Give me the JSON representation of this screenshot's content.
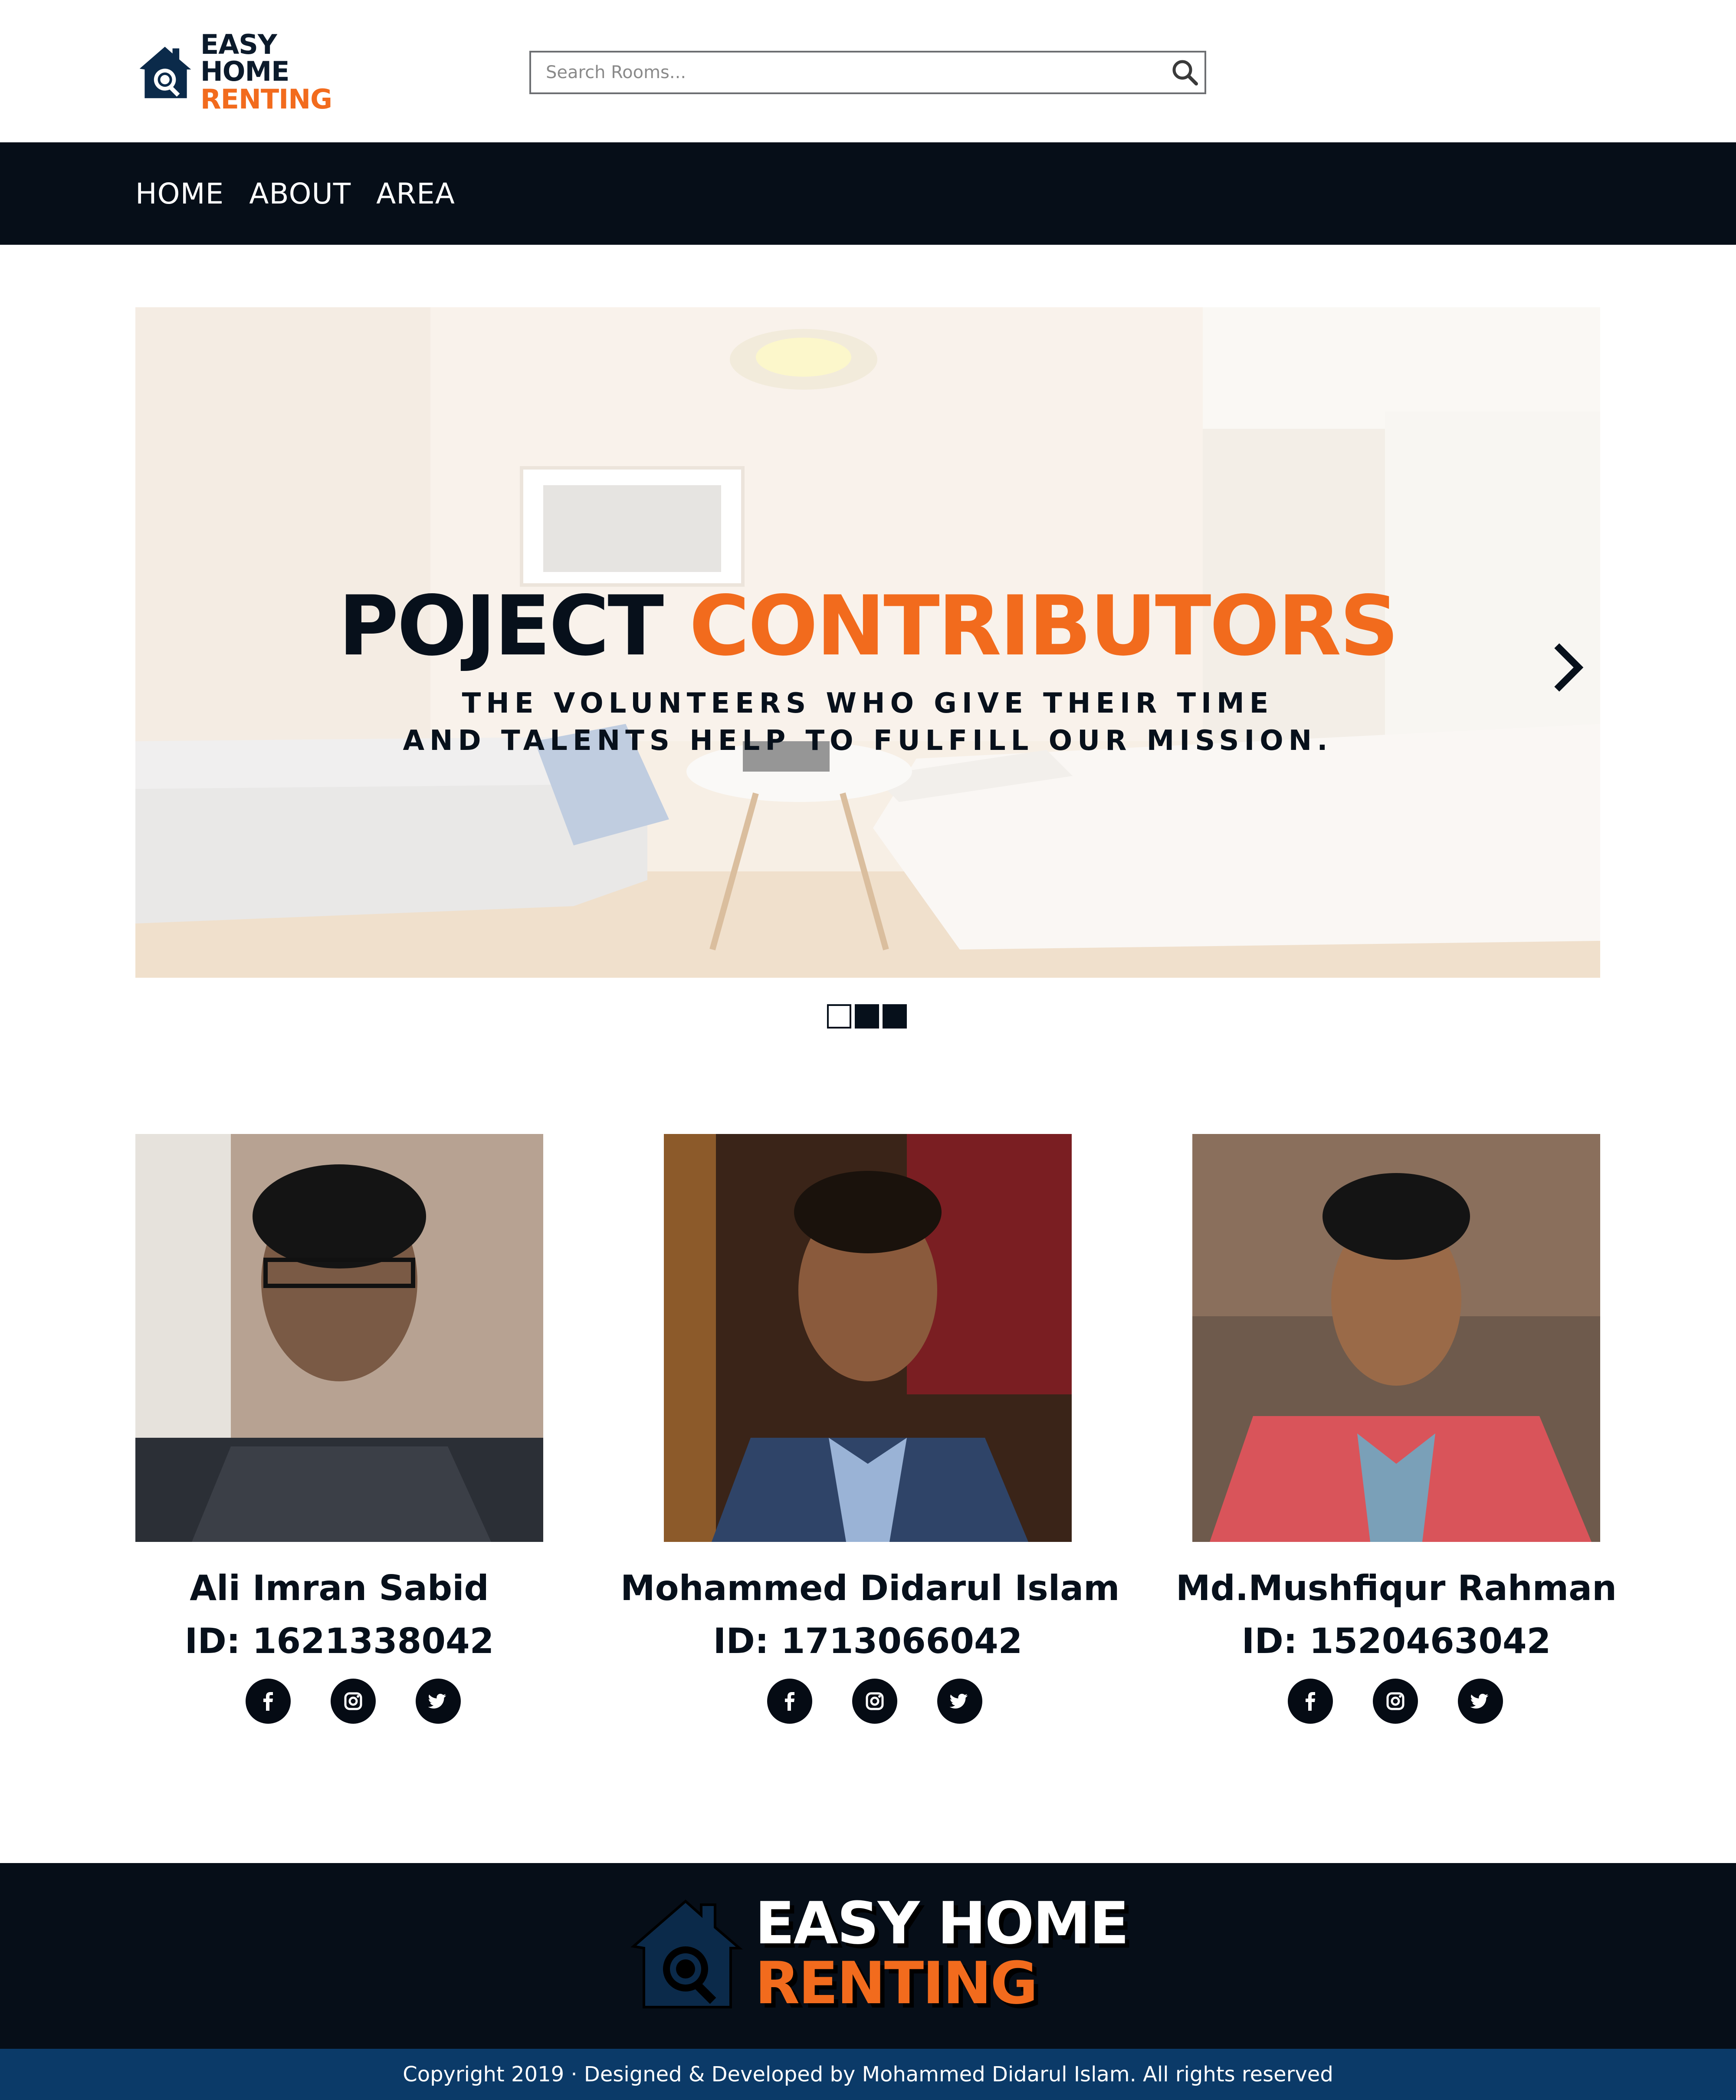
{
  "brand": {
    "line1": "EASY HOME",
    "line2": "RENTING",
    "colors": {
      "navy": "#0b1a2b",
      "orange": "#f26b1d",
      "dark": "#060e18",
      "footer_bar": "#0b3a68"
    }
  },
  "search": {
    "placeholder": "Search Rooms..."
  },
  "nav": {
    "items": [
      "HOME",
      "ABOUT",
      "AREA"
    ]
  },
  "hero": {
    "title_part1": "POJECT",
    "title_part2": "CONTRIBUTORS",
    "subtitle_line1": "THE VOLUNTEERS WHO GIVE THEIR TIME",
    "subtitle_line2": "AND TALENTS HELP TO FULFILL OUR MISSION.",
    "slides": 3,
    "active_slide": 1
  },
  "team": [
    {
      "name": "Ali Imran Sabid",
      "id": "ID: 1621338042",
      "socials": [
        "facebook-icon",
        "instagram-icon",
        "twitter-icon"
      ]
    },
    {
      "name": "Mohammed Didarul Islam",
      "id": "ID: 1713066042",
      "socials": [
        "facebook-icon",
        "instagram-icon",
        "twitter-icon"
      ]
    },
    {
      "name": "Md.Mushfiqur Rahman",
      "id": "ID: 1520463042",
      "socials": [
        "facebook-icon",
        "instagram-icon",
        "twitter-icon"
      ]
    }
  ],
  "footer": {
    "line1": "EASY HOME",
    "line2": "RENTING",
    "copyright": "Copyright 2019 · Designed & Developed by Mohammed Didarul Islam. All rights reserved"
  }
}
